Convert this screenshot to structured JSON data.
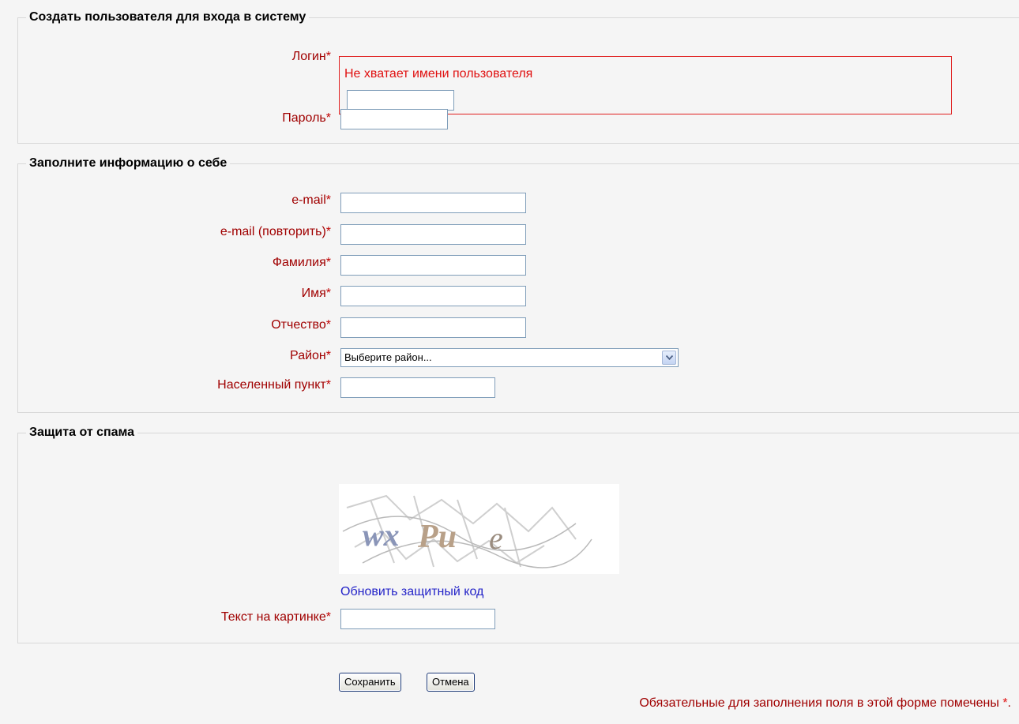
{
  "login_section": {
    "legend": "Создать пользователя для входа в систему",
    "login_label": "Логин",
    "login_error": "Не хватает имени пользователя",
    "login_value": "",
    "password_label": "Пароль",
    "password_value": ""
  },
  "required_marker": "*",
  "info_section": {
    "legend": "Заполните информацию о себе",
    "email_label": "e-mail",
    "email_repeat_label": "e-mail (повторить)",
    "lastname_label": "Фамилия",
    "firstname_label": "Имя",
    "patronymic_label": "Отчество",
    "district_label": "Район",
    "district_selected": "Выберите район...",
    "locality_label": "Населенный пункт"
  },
  "spam_section": {
    "legend": "Защита от спама",
    "captcha_text": "wxPu e",
    "refresh_link": "Обновить защитный код",
    "captcha_input_label": "Текст на картинке"
  },
  "buttons": {
    "save": "Сохранить",
    "cancel": "Отмена"
  },
  "footnote": "Обязательные для заполнения поля в этой форме помечены",
  "colors": {
    "label_red": "#a00000",
    "error_red": "#e01010",
    "link_blue": "#2323c8",
    "background": "#f5f5f5"
  }
}
